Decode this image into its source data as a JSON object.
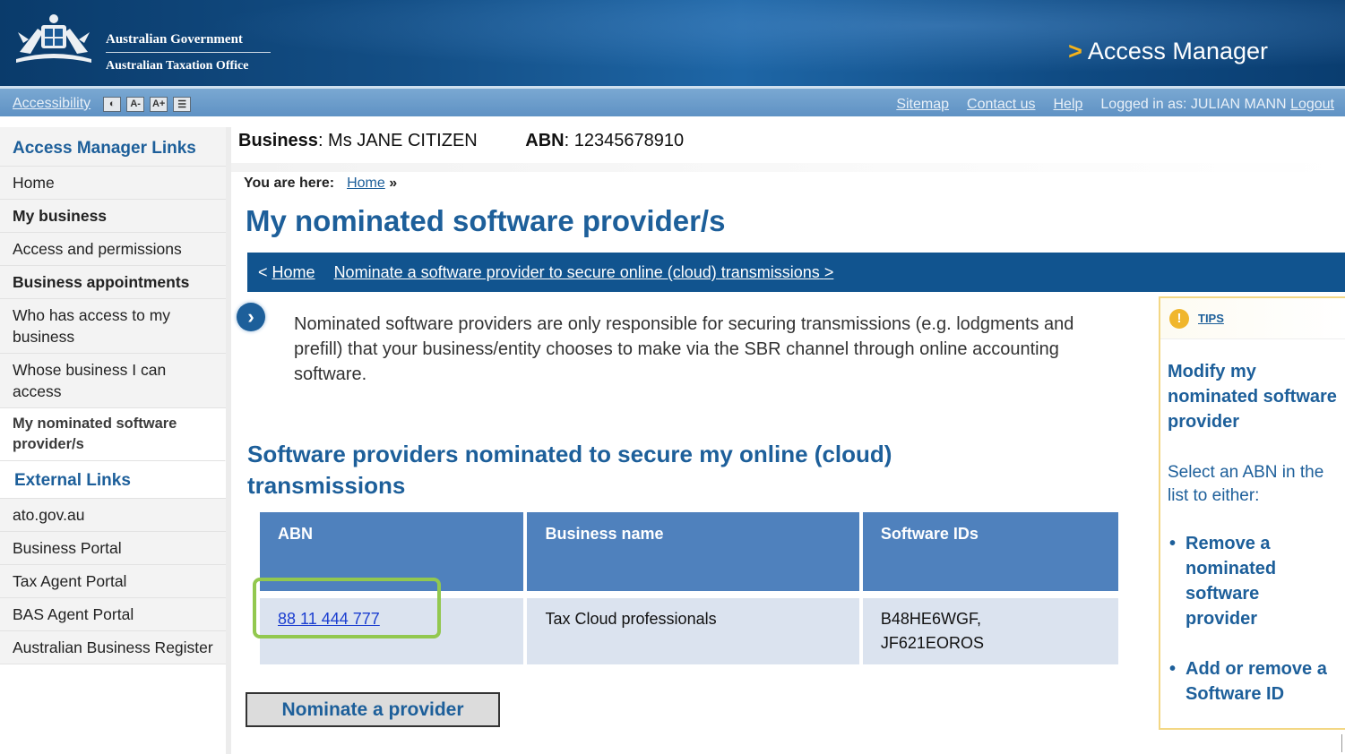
{
  "header": {
    "govt": "Australian Government",
    "agency": "Australian Taxation Office",
    "app_title": "Access Manager",
    "chevron": ">"
  },
  "utility": {
    "accessibility": "Accessibility",
    "contrast_icon": "contrast-icon",
    "font_decrease": "A-",
    "font_increase": "A+",
    "text_only_icon": "text-only-icon",
    "sitemap": "Sitemap",
    "contact": "Contact us",
    "help": "Help",
    "logged_in": "Logged in as: JULIAN MANN",
    "logout": "Logout"
  },
  "sidebar": {
    "heading": "Access Manager Links",
    "items": [
      {
        "label": "Home",
        "bold": false
      },
      {
        "label": "My business",
        "bold": true
      },
      {
        "label": "Access and permissions",
        "bold": false
      },
      {
        "label": "Business appointments",
        "bold": true
      },
      {
        "label": "Who has access to my business",
        "bold": false
      },
      {
        "label": "Whose business I can access",
        "bold": false
      },
      {
        "label": "My nominated software provider/s",
        "bold": true
      }
    ],
    "external_heading": "External Links",
    "external_items": [
      "ato.gov.au",
      "Business Portal",
      "Tax Agent Portal",
      "BAS Agent Portal",
      "Australian Business Register"
    ]
  },
  "main": {
    "business_label": "Business",
    "business_value": ": Ms JANE CITIZEN",
    "abn_label": "ABN",
    "abn_value": ": 12345678910",
    "you_are_here": "You are here:",
    "crumb_home": "Home",
    "crumb_sep": "»",
    "title": "My nominated software provider/s",
    "nav_prev": "<",
    "nav_home": "Home",
    "nav_next_link": "Nominate a  software provider to secure online (cloud) transmissions",
    "nav_next": ">",
    "info": "Nominated software providers are only responsible for securing transmissions (e.g. lodgments and prefill) that your business/entity chooses  to make via the SBR channel through online accounting software.",
    "section_title": "Software providers nominated to secure my online (cloud) transmissions",
    "table": {
      "headers": [
        "ABN",
        "Business name",
        "Software IDs"
      ],
      "rows": [
        {
          "abn": "88 11 444 777",
          "name": "Tax Cloud professionals",
          "ids_line1": "B48HE6WGF,",
          "ids_line2": "JF621EOROS"
        }
      ]
    },
    "nominate_button": "Nominate a provider"
  },
  "tips": {
    "label": "TIPS",
    "icon": "lightbulb-icon",
    "title": "Modify my nominated software provider",
    "desc": "Select an ABN in the list to either:",
    "items": [
      "Remove a nominated software provider",
      "Add or remove a Software ID"
    ]
  },
  "colors": {
    "brand_blue": "#1d5f9a",
    "nav_blue": "#11548f",
    "table_header": "#4f81bd",
    "table_row": "#dbe3ef",
    "highlight": "#92c84f",
    "tips_border": "#f3d784"
  }
}
